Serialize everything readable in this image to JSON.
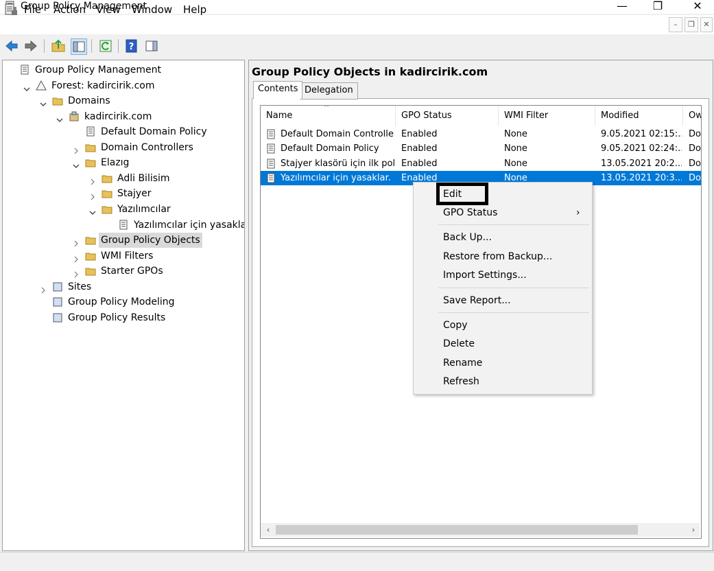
{
  "window": {
    "title": "Group Policy Management"
  },
  "menu": [
    "File",
    "Action",
    "View",
    "Window",
    "Help"
  ],
  "tree": [
    {
      "label": "Group Policy Management",
      "icon": "gpm-console-icon",
      "expander": ""
    },
    {
      "label": "Forest: kadircirik.com",
      "icon": "forest-icon",
      "expander": "open"
    },
    {
      "label": "Domains",
      "icon": "domains-folder-icon",
      "expander": "open"
    },
    {
      "label": "kadircirik.com",
      "icon": "domain-icon",
      "expander": "open"
    },
    {
      "label": "Default Domain Policy",
      "icon": "gpo-link-icon",
      "expander": ""
    },
    {
      "label": "Domain Controllers",
      "icon": "ou-folder-icon",
      "expander": "closed"
    },
    {
      "label": "Elazıg",
      "icon": "ou-folder-icon",
      "expander": "open"
    },
    {
      "label": "Adli Bilisim",
      "icon": "ou-folder-icon",
      "expander": "closed"
    },
    {
      "label": "Stajyer",
      "icon": "ou-folder-icon",
      "expander": "closed"
    },
    {
      "label": "Yazılımcılar",
      "icon": "ou-folder-icon",
      "expander": "open"
    },
    {
      "label": "Yazılımcılar için yasaklar.",
      "icon": "gpo-link-icon",
      "expander": ""
    },
    {
      "label": "Group Policy Objects",
      "icon": "gpo-folder-icon",
      "expander": "closed",
      "selected": true
    },
    {
      "label": "WMI Filters",
      "icon": "wmi-folder-icon",
      "expander": "closed"
    },
    {
      "label": "Starter GPOs",
      "icon": "starter-folder-icon",
      "expander": "closed"
    },
    {
      "label": "Sites",
      "icon": "sites-icon",
      "expander": "closed"
    },
    {
      "label": "Group Policy Modeling",
      "icon": "modeling-icon",
      "expander": ""
    },
    {
      "label": "Group Policy Results",
      "icon": "results-icon",
      "expander": ""
    }
  ],
  "right": {
    "title": "Group Policy Objects in kadircirik.com",
    "tabs": [
      "Contents",
      "Delegation"
    ],
    "columns": [
      "Name",
      "GPO Status",
      "WMI Filter",
      "Modified",
      "Ow"
    ],
    "rows": [
      {
        "name": "Default Domain Controller...",
        "status": "Enabled",
        "wmi": "None",
        "modified": "9.05.2021 02:15:...",
        "owner": "Do"
      },
      {
        "name": "Default Domain Policy",
        "status": "Enabled",
        "wmi": "None",
        "modified": "9.05.2021 02:24:...",
        "owner": "Do"
      },
      {
        "name": "Stajyer klasörü için ilk poli...",
        "status": "Enabled",
        "wmi": "None",
        "modified": "13.05.2021 20:2...",
        "owner": "Do"
      },
      {
        "name": "Yazılımcılar için yasaklar.",
        "status": "Enabled",
        "wmi": "None",
        "modified": "13.05.2021 20:3...",
        "owner": "Do",
        "selected": true
      }
    ]
  },
  "context_menu": {
    "items": [
      "Edit",
      "GPO Status",
      "Back Up...",
      "Restore from Backup...",
      "Import Settings...",
      "Save Report...",
      "Copy",
      "Delete",
      "Rename",
      "Refresh"
    ]
  },
  "colors": {
    "selection": "#0078d7",
    "highlight_box": "#000000"
  }
}
